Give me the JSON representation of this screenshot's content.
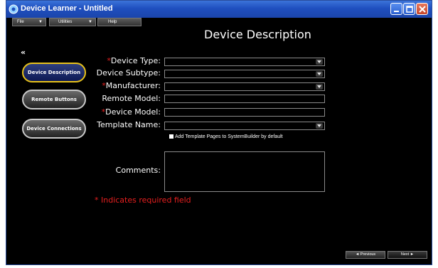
{
  "window": {
    "title": "Device Learner - Untitled"
  },
  "menu": [
    {
      "label": "File"
    },
    {
      "label": "Utilities"
    },
    {
      "label": "Help"
    }
  ],
  "page": {
    "title": "Device Description",
    "collapse_glyph": "«"
  },
  "nav": [
    {
      "label": "Device Description",
      "active": true
    },
    {
      "label": "Remote Buttons",
      "active": false
    },
    {
      "label": "Device Connections",
      "active": false
    }
  ],
  "form": {
    "device_type": {
      "label": "Device Type:",
      "required_mark": "*",
      "value": ""
    },
    "device_subtype": {
      "label": "Device Subtype:",
      "value": ""
    },
    "manufacturer": {
      "label": "Manufacturer:",
      "required_mark": "*",
      "value": ""
    },
    "remote_model": {
      "label": "Remote Model:",
      "value": ""
    },
    "device_model": {
      "label": "Device Model:",
      "required_mark": "*",
      "value": ""
    },
    "template_name": {
      "label": "Template Name:",
      "value": ""
    },
    "add_template_checkbox": {
      "label": "Add Template Pages to SystemBuilder by default",
      "checked": false
    },
    "comments": {
      "label": "Comments:",
      "value": ""
    },
    "required_note": "* Indicates required field"
  },
  "footer": {
    "previous_label": "◄ Previous",
    "next_label": "Next ►"
  },
  "colors": {
    "accent": "#e8c21a",
    "required": "#e81f1f",
    "titlebar": "#1f4fbf"
  }
}
